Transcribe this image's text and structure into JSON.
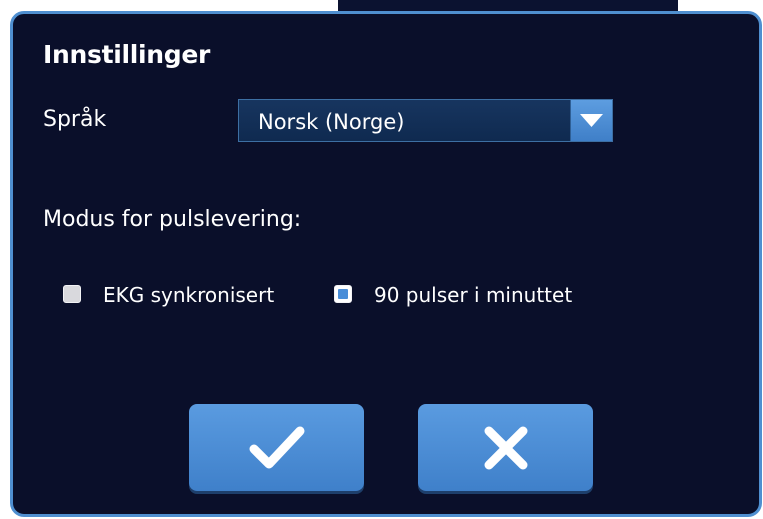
{
  "dialog": {
    "title": "Innstillinger",
    "language": {
      "label": "Språk",
      "selected": "Norsk (Norge)"
    },
    "delivery_mode": {
      "label": "Modus for pulslevering:",
      "options": [
        {
          "label": "EKG synkronisert",
          "checked": false
        },
        {
          "label": "90 pulser i minuttet",
          "checked": true
        }
      ]
    },
    "buttons": {
      "confirm_icon": "checkmark-icon",
      "cancel_icon": "close-x-icon"
    }
  },
  "colors": {
    "dialog_background": "#0a0f2a",
    "accent": "#4a8ed8",
    "border": "#4f8fd0"
  }
}
